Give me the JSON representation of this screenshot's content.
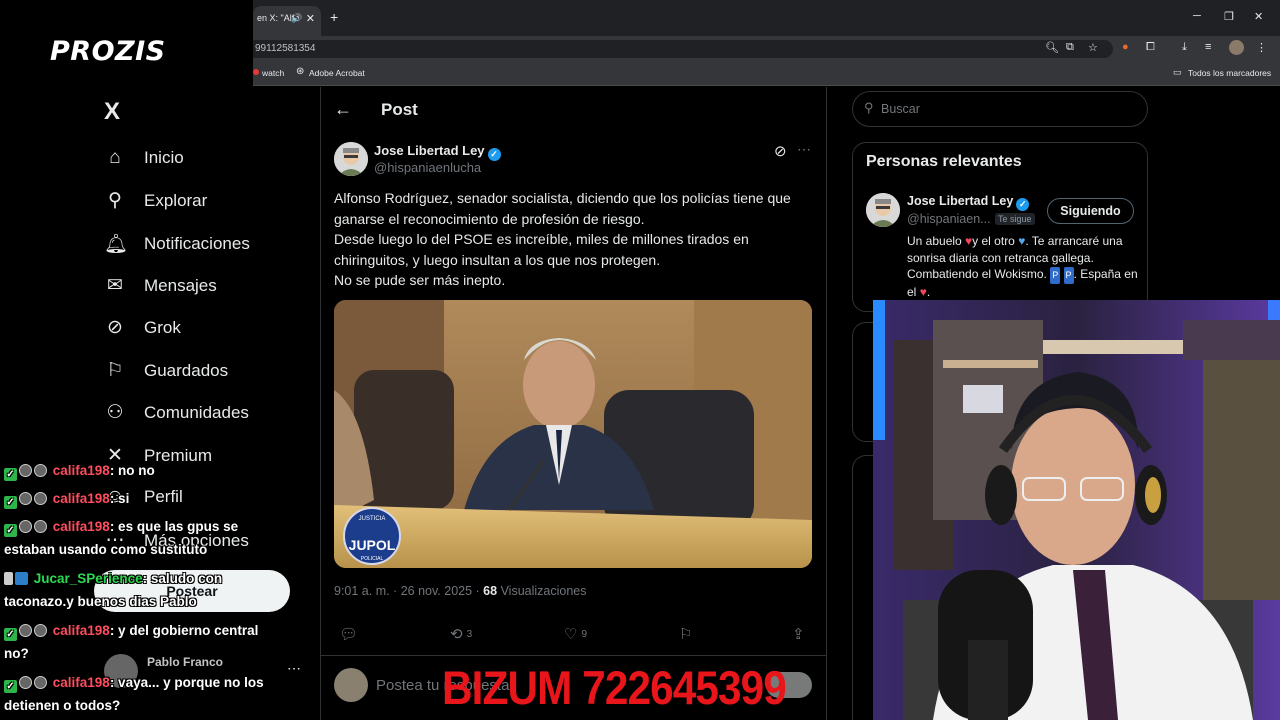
{
  "browser": {
    "tab_title": "en X: \"Alfo",
    "url_fragment": "99112581354",
    "bookmarks": [
      "watch",
      "Adobe Acrobat"
    ],
    "all_bookmarks": "Todos los marcadores"
  },
  "overlay": {
    "logo": "PROZIS",
    "bizum": "BIZUM 722645399"
  },
  "x_nav": {
    "logo": "X",
    "items": [
      {
        "label": "Inicio",
        "icon": "home-icon"
      },
      {
        "label": "Explorar",
        "icon": "search-icon"
      },
      {
        "label": "Notificaciones",
        "icon": "bell-icon"
      },
      {
        "label": "Mensajes",
        "icon": "mail-icon"
      },
      {
        "label": "Grok",
        "icon": "grok-icon"
      },
      {
        "label": "Guardados",
        "icon": "bookmark-icon"
      },
      {
        "label": "Comunidades",
        "icon": "people-icon"
      },
      {
        "label": "Premium",
        "icon": "x-premium-icon"
      },
      {
        "label": "Perfil",
        "icon": "person-icon"
      },
      {
        "label": "Más opciones",
        "icon": "more-icon"
      }
    ],
    "post_button": "Postear",
    "account_name": "Pablo Franco"
  },
  "post": {
    "header": "Post",
    "author_name": "Jose Libertad Ley",
    "author_handle": "@hispaniaenlucha",
    "text_lines": [
      "Alfonso Rodríguez, senador socialista, diciendo que los policías tiene que ganarse el reconocimiento de profesión de riesgo.",
      "Desde luego lo del PSOE es increíble, miles de millones tirados en chiringuitos, y luego insultan a los que nos protegen.",
      "No se pude ser más inepto."
    ],
    "video_watermark_top": "JUSTICIA",
    "video_watermark": "JUPOL",
    "video_watermark_bottom": "POLICIAL",
    "time": "9:01 a. m. · 26 nov. 2025 · ",
    "views": "68",
    "views_label": "Visualizaciones",
    "reposts": "3",
    "likes": "9",
    "reply_placeholder": "Postea tu respuesta"
  },
  "sidebar": {
    "search_placeholder": "Buscar",
    "relevant_title": "Personas relevantes",
    "relevant_name": "Jose Libertad Ley",
    "relevant_handle": "@hispaniaen...",
    "relevant_badge": "Te sigue",
    "follow_label": "Siguiendo",
    "bio_parts": [
      "Un abuelo ",
      "♥",
      "y el otro ",
      "♥",
      ". Te arrancaré una sonrisa diaria con retranca gallega. Combatiendo el Wokismo. ",
      "P",
      " ",
      "P",
      ". España en el ",
      "♥",
      "."
    ]
  },
  "chat": [
    {
      "user": "califa198",
      "text": ": no no"
    },
    {
      "user": "califa198",
      "text": ": si"
    },
    {
      "user": "califa198",
      "text": ": es que las gpus se estaban usando como sustituto"
    },
    {
      "user": "Jucar_SPerience",
      "text": ": saludo con taconazo.y buenos dias Pablo"
    },
    {
      "user": "califa198",
      "text": ": y del gobierno central no?"
    },
    {
      "user": "califa198",
      "text": ": vaya... y porque no los detienen o todos?"
    }
  ]
}
